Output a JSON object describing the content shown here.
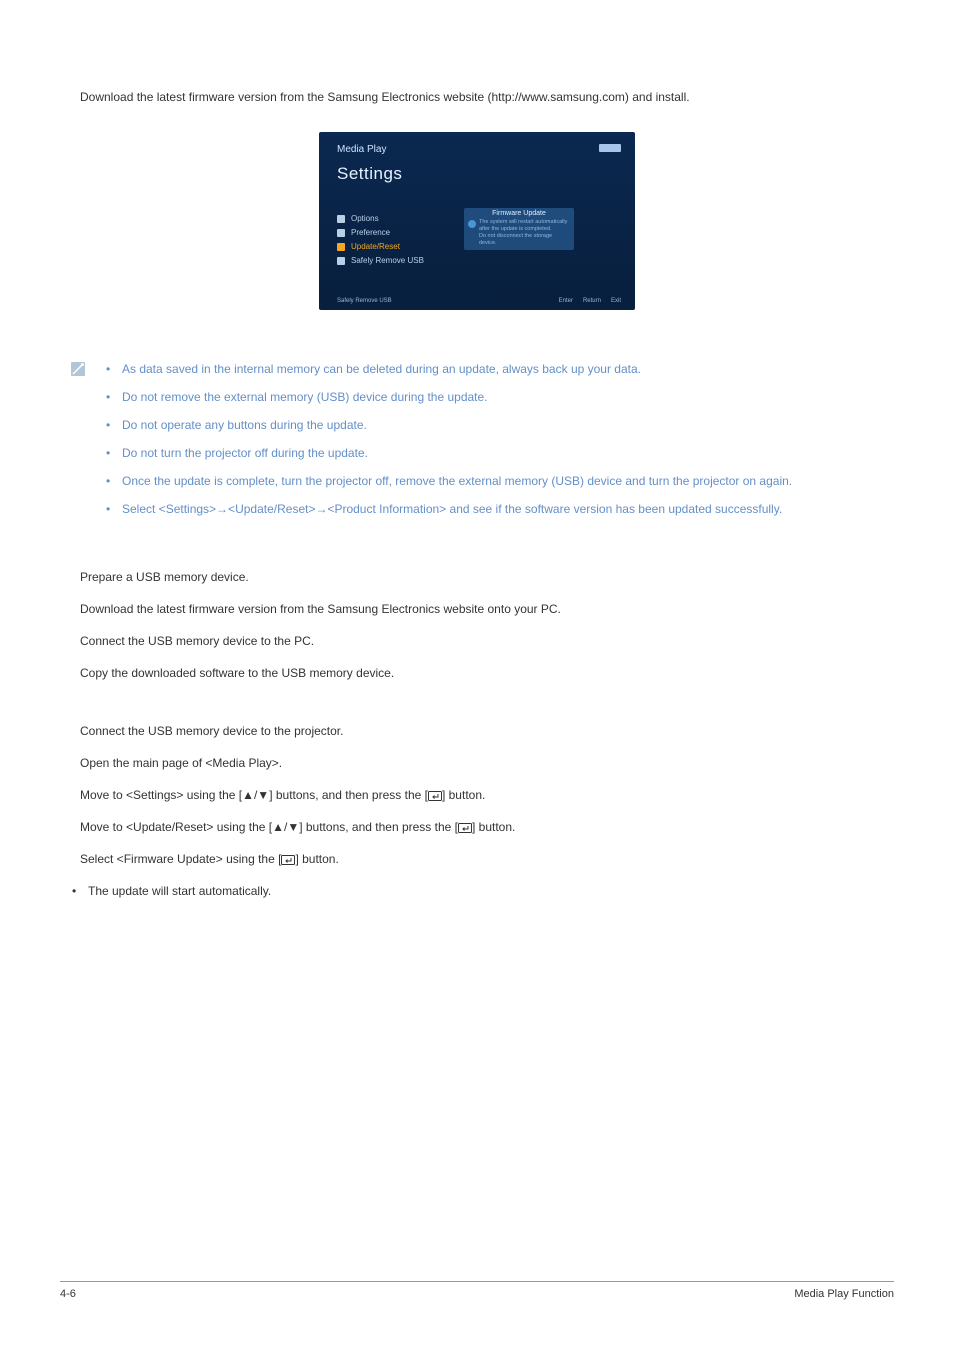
{
  "intro": "Download the latest firmware version from the Samsung Electronics website (http://www.samsung.com) and install.",
  "screenshot": {
    "media_play": "Media Play",
    "settings": "Settings",
    "menu": {
      "options": "Options",
      "preference": "Preference",
      "update_reset": "Update/Reset",
      "safety_remove": "Safely Remove USB"
    },
    "panel": {
      "title": "Firmware Update",
      "line1": "The system will restart automatically",
      "line2": "after the update is completed.",
      "line3": "Do not disconnect the storage device."
    },
    "footer_left": "Safely Remove USB",
    "footer_enter": "Enter",
    "footer_return": "Return",
    "footer_exit": "Exit"
  },
  "cautions": {
    "item1": "As data saved in the internal memory can be deleted during an update, always back up your data.",
    "item2": "Do not remove the external memory (USB) device during the update.",
    "item3": "Do not operate any buttons during the update.",
    "item4": "Do not turn the projector off during the update.",
    "item5": "Once the update is complete, turn the projector off, remove the external memory (USB) device and turn the projector on again.",
    "item6": "Select <Settings>→<Update/Reset>→<Product Information> and see if the software version has been updated successfully."
  },
  "prep": {
    "step1": "Prepare a USB memory device.",
    "step2": "Download the latest firmware version from the Samsung Electronics website onto your PC.",
    "step3": "Connect the USB memory device to the PC.",
    "step4": "Copy the downloaded software to the USB memory device."
  },
  "update": {
    "step1": "Connect the USB memory device to the projector.",
    "step2": "Open the main page of <Media Play>.",
    "step3_a": "Move to <Settings> using the [▲/▼] buttons, and then press the [",
    "step3_b": "] button.",
    "step4_a": "Move to <Update/Reset> using the [▲/▼] buttons, and then press the [",
    "step4_b": "] button.",
    "step5_a": "Select <Firmware Update> using the [",
    "step5_b": "] button.",
    "auto": "The update will start automatically."
  },
  "footer": {
    "left": "4-6",
    "right": "Media Play Function"
  }
}
